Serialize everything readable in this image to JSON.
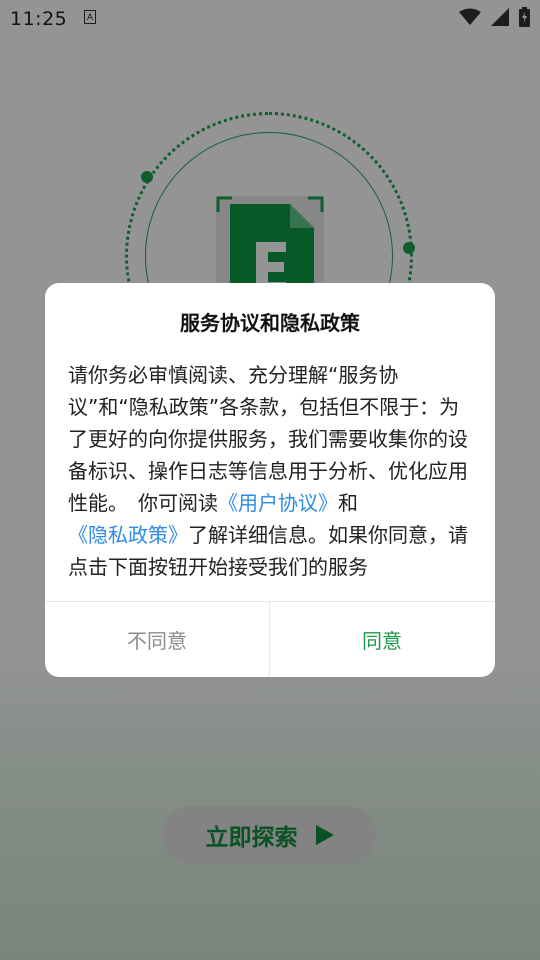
{
  "status_bar": {
    "time": "11:25",
    "icons": [
      "a-accessibility-icon",
      "wifi-icon",
      "cell-signal-icon",
      "battery-charging-icon"
    ]
  },
  "background": {
    "app_icon": "excel-file-icon",
    "accent_color": "#1aa14d",
    "explore_button_label": "立即探索"
  },
  "dialog": {
    "title": "服务协议和隐私政策",
    "body_part1": "请你务必审慎阅读、充分理解“服务协议”和“隐私政策”各条款，包括但不限于：为了更好的向你提供服务，我们需要收集你的设备标识、操作日志等信息用于分析、优化应用性能。　你可阅读",
    "link_user_agreement": "《用户协议》",
    "body_and": "和",
    "link_privacy_policy": "《隐私政策》",
    "body_part2": "了解详细信息。如果你同意，请点击下面按钮开始接受我们的服务",
    "disagree_label": "不同意",
    "agree_label": "同意",
    "link_color": "#2f8be6",
    "agree_color": "#1a9b43"
  }
}
